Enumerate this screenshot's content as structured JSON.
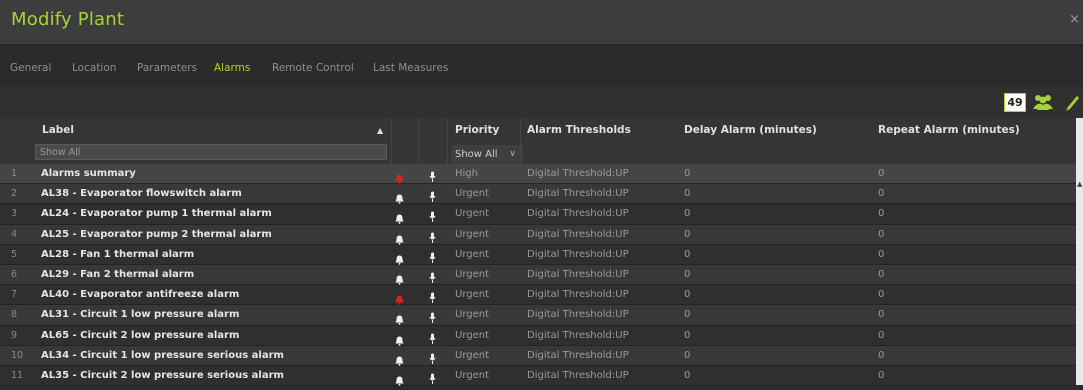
{
  "window": {
    "title": "Modify Plant",
    "close_glyph": "×"
  },
  "tabs": [
    {
      "label": "General",
      "active": false
    },
    {
      "label": "Location",
      "active": false
    },
    {
      "label": "Parameters",
      "active": false
    },
    {
      "label": "Alarms",
      "active": true
    },
    {
      "label": "Remote Control",
      "active": false
    },
    {
      "label": "Last Measures",
      "active": false
    }
  ],
  "toolbar": {
    "count_badge": "49",
    "icons": [
      "users-icon",
      "pencil-icon"
    ]
  },
  "grid": {
    "columns": {
      "label": "Label",
      "priority": "Priority",
      "thresholds": "Alarm Thresholds",
      "delay": "Delay Alarm (minutes)",
      "repeat": "Repeat Alarm (minutes)"
    },
    "sort_indicator": "▲",
    "filters": {
      "label_placeholder": "Show All",
      "priority_value": "Show All",
      "priority_chevron": "∨"
    },
    "rows": [
      {
        "num": "1",
        "label": "Alarms summary",
        "bell": "red",
        "priority": "High",
        "threshold": "Digital Threshold:UP",
        "delay": "0",
        "repeat": "0"
      },
      {
        "num": "2",
        "label": "AL38 - Evaporator flowswitch alarm",
        "bell": "white",
        "priority": "Urgent",
        "threshold": "Digital Threshold:UP",
        "delay": "0",
        "repeat": "0"
      },
      {
        "num": "3",
        "label": "AL24 - Evaporator pump 1 thermal alarm",
        "bell": "white",
        "priority": "Urgent",
        "threshold": "Digital Threshold:UP",
        "delay": "0",
        "repeat": "0"
      },
      {
        "num": "4",
        "label": "AL25 - Evaporator pump 2 thermal alarm",
        "bell": "white",
        "priority": "Urgent",
        "threshold": "Digital Threshold:UP",
        "delay": "0",
        "repeat": "0"
      },
      {
        "num": "5",
        "label": "AL28 - Fan 1 thermal alarm",
        "bell": "white",
        "priority": "Urgent",
        "threshold": "Digital Threshold:UP",
        "delay": "0",
        "repeat": "0"
      },
      {
        "num": "6",
        "label": "AL29 - Fan 2 thermal alarm",
        "bell": "white",
        "priority": "Urgent",
        "threshold": "Digital Threshold:UP",
        "delay": "0",
        "repeat": "0"
      },
      {
        "num": "7",
        "label": "AL40 - Evaporator antifreeze alarm",
        "bell": "red",
        "priority": "Urgent",
        "threshold": "Digital Threshold:UP",
        "delay": "0",
        "repeat": "0"
      },
      {
        "num": "8",
        "label": "AL31 - Circuit 1 low pressure alarm",
        "bell": "white",
        "priority": "Urgent",
        "threshold": "Digital Threshold:UP",
        "delay": "0",
        "repeat": "0"
      },
      {
        "num": "9",
        "label": "AL65 - Circuit 2 low pressure alarm",
        "bell": "white",
        "priority": "Urgent",
        "threshold": "Digital Threshold:UP",
        "delay": "0",
        "repeat": "0"
      },
      {
        "num": "10",
        "label": "AL34 - Circuit 1 low pressure serious alarm",
        "bell": "white",
        "priority": "Urgent",
        "threshold": "Digital Threshold:UP",
        "delay": "0",
        "repeat": "0"
      },
      {
        "num": "11",
        "label": "AL35 - Circuit 2 low pressure serious alarm",
        "bell": "white",
        "priority": "Urgent",
        "threshold": "Digital Threshold:UP",
        "delay": "0",
        "repeat": "0"
      }
    ]
  },
  "colors": {
    "accent": "#a8d23a",
    "bell_red": "#e02020",
    "bell_white": "#f0f0f0"
  }
}
